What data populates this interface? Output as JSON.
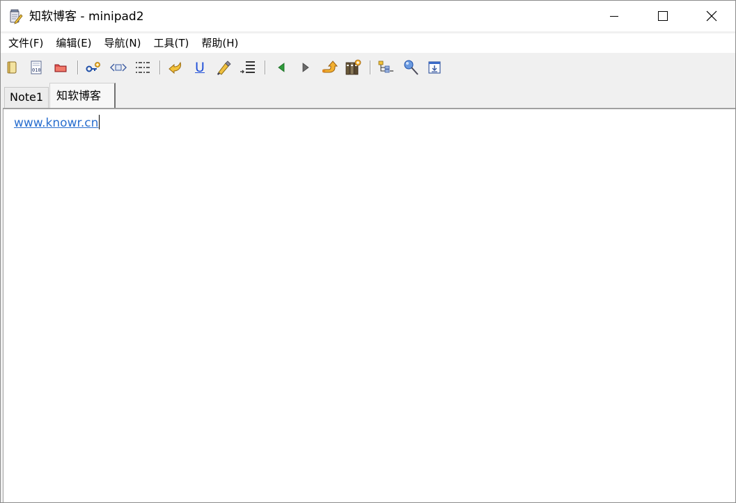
{
  "window": {
    "title": "知软博客 - minipad2",
    "controls": {
      "minimize_icon": "minimize-icon",
      "maximize_icon": "maximize-icon",
      "close_icon": "close-icon"
    }
  },
  "menu": {
    "items": [
      {
        "id": "file",
        "label": "文件(F)"
      },
      {
        "id": "edit",
        "label": "编辑(E)"
      },
      {
        "id": "navigate",
        "label": "导航(N)"
      },
      {
        "id": "tools",
        "label": "工具(T)"
      },
      {
        "id": "help",
        "label": "帮助(H)"
      }
    ]
  },
  "toolbar": {
    "icons": [
      "new-note-icon",
      "binary-note-icon",
      "folder-icon",
      "link-add-icon",
      "tag-icon",
      "list-icon",
      "undo-icon",
      "underline-icon",
      "highlighter-icon",
      "line-list-icon",
      "back-arrow-icon",
      "forward-arrow-icon",
      "up-level-icon",
      "book-add-icon",
      "tree-icon",
      "pin-icon",
      "download-icon"
    ],
    "underline_glyph": "U"
  },
  "tabs": {
    "items": [
      {
        "label": "Note1",
        "active": false
      },
      {
        "label": "知软博客",
        "active": true
      }
    ]
  },
  "editor": {
    "content_link": "www.knowr.cn"
  },
  "colors": {
    "link": "#2a6fcf",
    "toolbar_bg": "#f0f0f0",
    "nav_green": "#2e9a3a"
  }
}
